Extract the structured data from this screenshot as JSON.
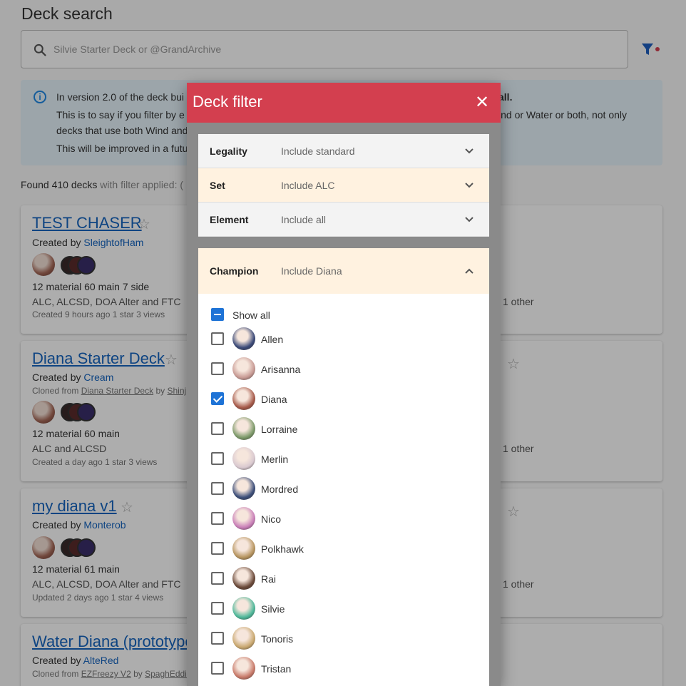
{
  "page": {
    "title": "Deck search",
    "search_placeholder": "Silvie Starter Deck or @GrandArchive"
  },
  "info": {
    "line1_start": "In version 2.0 of the deck bui",
    "line1_end": "all.",
    "line2_start": "This is to say if you filter by e",
    "line2_end": "ind or Water or both, not only",
    "line3": "decks that use both Wind and",
    "line4": "This will be improved in a futu"
  },
  "found": {
    "count_text": "Found 410 decks",
    "suffix": "with filter applied: ("
  },
  "decks": [
    {
      "title": "TEST CHASER",
      "created_prefix": "Created by",
      "author": "SleightofHam",
      "stats": "12 material   60 main   7 side",
      "sets": "ALC, ALCSD, DOA Alter and FTC",
      "meta": "Created 9 hours ago   1 star   3 views",
      "other": "1 other"
    },
    {
      "title": "Diana Starter Deck",
      "created_prefix": "Created by",
      "author": "Cream",
      "cloned_prefix": "Cloned from",
      "cloned_name": "Diana Starter Deck",
      "cloned_by": "by",
      "cloned_author": "Shinj",
      "stats": "12 material   60 main",
      "sets": "ALC and ALCSD",
      "meta": "Created a day ago   1 star   3 views",
      "other": "1 other"
    },
    {
      "title": "my diana v1",
      "created_prefix": "Created by",
      "author": "Monterob",
      "stats": "12 material   61 main",
      "sets": "ALC, ALCSD, DOA Alter and FTC",
      "meta": "Updated 2 days ago   1 star   4 views",
      "other": "1 other"
    },
    {
      "title": "Water Diana (prototype",
      "created_prefix": "Created by",
      "author": "AlteRed",
      "cloned_prefix": "Cloned from",
      "cloned_name": "EZFreezy V2",
      "cloned_by": "by",
      "cloned_author": "SpaghEddi"
    }
  ],
  "dialog": {
    "title": "Deck filter",
    "close_glyph": "✕",
    "filters": [
      {
        "label": "Legality",
        "value": "Include standard"
      },
      {
        "label": "Set",
        "value": "Include ALC"
      },
      {
        "label": "Element",
        "value": "Include all"
      }
    ],
    "champion": {
      "label": "Champion",
      "value": "Include Diana",
      "show_all": "Show all",
      "options": [
        {
          "name": "Allen",
          "checked": false,
          "color": "#3b4a78"
        },
        {
          "name": "Arisanna",
          "checked": false,
          "color": "#c79a94"
        },
        {
          "name": "Diana",
          "checked": true,
          "color": "#a65a4a"
        },
        {
          "name": "Lorraine",
          "checked": false,
          "color": "#7d9a6a"
        },
        {
          "name": "Merlin",
          "checked": false,
          "color": "#d9c9d0"
        },
        {
          "name": "Mordred",
          "checked": false,
          "color": "#3d4f7a"
        },
        {
          "name": "Nico",
          "checked": false,
          "color": "#c97fb8"
        },
        {
          "name": "Polkhawk",
          "checked": false,
          "color": "#b79560"
        },
        {
          "name": "Rai",
          "checked": false,
          "color": "#6b4a3a"
        },
        {
          "name": "Silvie",
          "checked": false,
          "color": "#4fb89a"
        },
        {
          "name": "Tonoris",
          "checked": false,
          "color": "#c9a870"
        },
        {
          "name": "Tristan",
          "checked": false,
          "color": "#c87a6a"
        }
      ]
    }
  }
}
